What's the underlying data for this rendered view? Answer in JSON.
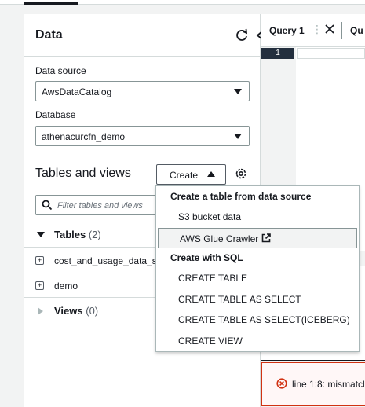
{
  "data_panel": {
    "title": "Data",
    "data_source_label": "Data source",
    "data_source_value": "AwsDataCatalog",
    "database_label": "Database",
    "database_value": "athenacurcfn_demo",
    "tables_and_views_title": "Tables and views",
    "create_label": "Create",
    "filter_placeholder": "Filter tables and views",
    "tables_label": "Tables",
    "tables_count": "(2)",
    "tables": [
      "cost_and_usage_data_st",
      "demo"
    ],
    "views_label": "Views",
    "views_count": "(0)"
  },
  "create_menu": {
    "group1": "Create a table from data source",
    "item_s3": "S3 bucket data",
    "item_glue": "AWS Glue Crawler",
    "group2": "Create with SQL",
    "item_create_table": "CREATE TABLE",
    "item_ctas": "CREATE TABLE AS SELECT",
    "item_ctas_iceberg": "CREATE TABLE AS SELECT(ICEBERG)",
    "item_create_view": "CREATE VIEW"
  },
  "query_editor": {
    "tab1_label": "Query 1",
    "tab2_label": "Qu",
    "line_number": "1",
    "error_message": "line 1:8: mismatcl"
  },
  "colors": {
    "accent": "#16191f",
    "error": "#d13212",
    "gutter_active": "#232f3e"
  },
  "icons": [
    "refresh-icon",
    "collapse-icon",
    "settings-icon",
    "search-icon",
    "external-link-icon",
    "close-icon",
    "error-icon"
  ]
}
